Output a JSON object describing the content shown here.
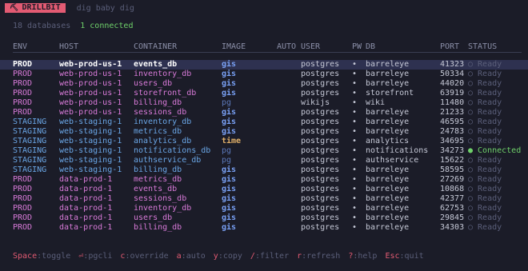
{
  "app": {
    "title": "DRILLBIT",
    "icon": "drill-icon",
    "tagline": "dig baby dig",
    "db_count_text": "18 databases",
    "connected_text": "1 connected"
  },
  "columns": [
    "ENV",
    "HOST",
    "CONTAINER",
    "IMAGE",
    "AUTO",
    "USER",
    "PW",
    "DB",
    "PORT",
    "STATUS"
  ],
  "rows": [
    {
      "env": "PROD",
      "host": "web-prod-us-1",
      "container": "events_db",
      "image": "gis",
      "auto": "",
      "user": "postgres",
      "pw": "•",
      "db": "barreleye",
      "port": "41323",
      "status": "○ Ready",
      "selected": true
    },
    {
      "env": "PROD",
      "host": "web-prod-us-1",
      "container": "inventory_db",
      "image": "gis",
      "auto": "",
      "user": "postgres",
      "pw": "•",
      "db": "barreleye",
      "port": "50334",
      "status": "○ Ready"
    },
    {
      "env": "PROD",
      "host": "web-prod-us-1",
      "container": "users_db",
      "image": "gis",
      "auto": "",
      "user": "postgres",
      "pw": "•",
      "db": "barreleye",
      "port": "44020",
      "status": "○ Ready"
    },
    {
      "env": "PROD",
      "host": "web-prod-us-1",
      "container": "storefront_db",
      "image": "gis",
      "auto": "",
      "user": "postgres",
      "pw": "•",
      "db": "storefront",
      "port": "63919",
      "status": "○ Ready"
    },
    {
      "env": "PROD",
      "host": "web-prod-us-1",
      "container": "billing_db",
      "image": "pg",
      "auto": "",
      "user": "wikijs",
      "pw": "•",
      "db": "wiki",
      "port": "11480",
      "status": "○ Ready"
    },
    {
      "env": "PROD",
      "host": "web-prod-us-1",
      "container": "sessions_db",
      "image": "gis",
      "auto": "",
      "user": "postgres",
      "pw": "•",
      "db": "barreleye",
      "port": "21233",
      "status": "○ Ready"
    },
    {
      "env": "STAGING",
      "host": "web-staging-1",
      "container": "inventory_db",
      "image": "gis",
      "auto": "",
      "user": "postgres",
      "pw": "•",
      "db": "barreleye",
      "port": "46595",
      "status": "○ Ready"
    },
    {
      "env": "STAGING",
      "host": "web-staging-1",
      "container": "metrics_db",
      "image": "gis",
      "auto": "",
      "user": "postgres",
      "pw": "•",
      "db": "barreleye",
      "port": "24783",
      "status": "○ Ready"
    },
    {
      "env": "STAGING",
      "host": "web-staging-1",
      "container": "analytics_db",
      "image": "time",
      "auto": "",
      "user": "postgres",
      "pw": "•",
      "db": "analytics",
      "port": "34695",
      "status": "○ Ready"
    },
    {
      "env": "STAGING",
      "host": "web-staging-1",
      "container": "notifications_db",
      "image": "pg",
      "auto": "",
      "user": "postgres",
      "pw": "•",
      "db": "notifications",
      "port": "34273",
      "status": "● Connected",
      "connected": true
    },
    {
      "env": "STAGING",
      "host": "web-staging-1",
      "container": "authservice_db",
      "image": "pg",
      "auto": "",
      "user": "postgres",
      "pw": "•",
      "db": "authservice",
      "port": "15622",
      "status": "○ Ready"
    },
    {
      "env": "STAGING",
      "host": "web-staging-1",
      "container": "billing_db",
      "image": "gis",
      "auto": "",
      "user": "postgres",
      "pw": "•",
      "db": "barreleye",
      "port": "58595",
      "status": "○ Ready"
    },
    {
      "env": "PROD",
      "host": "data-prod-1",
      "container": "metrics_db",
      "image": "gis",
      "auto": "",
      "user": "postgres",
      "pw": "•",
      "db": "barreleye",
      "port": "27269",
      "status": "○ Ready"
    },
    {
      "env": "PROD",
      "host": "data-prod-1",
      "container": "events_db",
      "image": "gis",
      "auto": "",
      "user": "postgres",
      "pw": "•",
      "db": "barreleye",
      "port": "10868",
      "status": "○ Ready"
    },
    {
      "env": "PROD",
      "host": "data-prod-1",
      "container": "sessions_db",
      "image": "gis",
      "auto": "",
      "user": "postgres",
      "pw": "•",
      "db": "barreleye",
      "port": "42377",
      "status": "○ Ready"
    },
    {
      "env": "PROD",
      "host": "data-prod-1",
      "container": "inventory_db",
      "image": "gis",
      "auto": "",
      "user": "postgres",
      "pw": "•",
      "db": "barreleye",
      "port": "62753",
      "status": "○ Ready"
    },
    {
      "env": "PROD",
      "host": "data-prod-1",
      "container": "users_db",
      "image": "gis",
      "auto": "",
      "user": "postgres",
      "pw": "•",
      "db": "barreleye",
      "port": "29845",
      "status": "○ Ready"
    },
    {
      "env": "PROD",
      "host": "data-prod-1",
      "container": "billing_db",
      "image": "gis",
      "auto": "",
      "user": "postgres",
      "pw": "•",
      "db": "barreleye",
      "port": "34303",
      "status": "○ Ready"
    }
  ],
  "footer": [
    {
      "key": "Space",
      "label": ":toggle"
    },
    {
      "key": "⏎",
      "label": ":pgcli"
    },
    {
      "key": "c",
      "label": ":override"
    },
    {
      "key": "a",
      "label": ":auto"
    },
    {
      "key": "y",
      "label": ":copy"
    },
    {
      "key": "/",
      "label": ":filter"
    },
    {
      "key": "r",
      "label": ":refresh"
    },
    {
      "key": "?",
      "label": ":help"
    },
    {
      "key": "Esc",
      "label": ":quit"
    }
  ],
  "colors": {
    "background": "#1b1c28",
    "brand": "#e35b73",
    "prod": "#d87ad8",
    "staging": "#6aa6e6",
    "connected": "#6fd16a",
    "selected_row": "#2e3150"
  }
}
